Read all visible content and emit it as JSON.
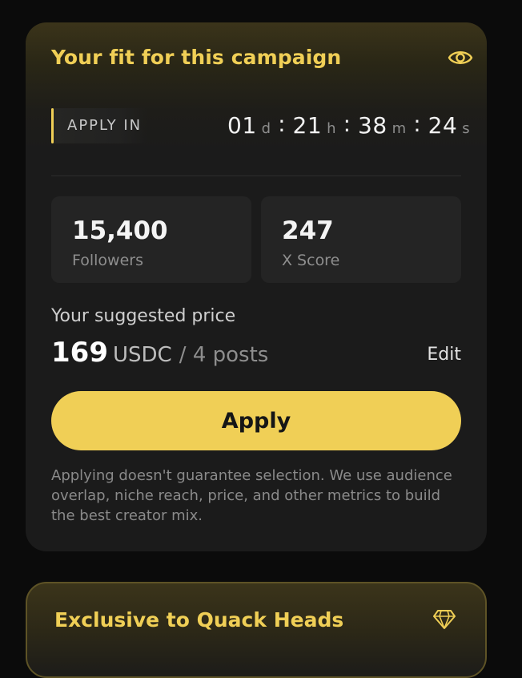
{
  "card": {
    "title": "Your fit for this campaign",
    "eye_icon": "eye-icon"
  },
  "countdown": {
    "label": "APPLY IN",
    "days": "01",
    "days_unit": "d",
    "hours": "21",
    "hours_unit": "h",
    "minutes": "38",
    "minutes_unit": "m",
    "seconds": "24",
    "seconds_unit": "s",
    "separator": ":"
  },
  "stats": [
    {
      "value": "15,400",
      "label": "Followers"
    },
    {
      "value": "247",
      "label": "X Score"
    }
  ],
  "price": {
    "label": "Your suggested price",
    "amount": "169",
    "currency": "USDC",
    "per": "/ 4 posts",
    "edit_label": "Edit"
  },
  "apply_button": {
    "label": "Apply"
  },
  "disclaimer": "Applying doesn't guarantee selection. We use audience overlap, niche reach, price, and other metrics to build the best creator mix.",
  "exclusive": {
    "title": "Exclusive to Quack Heads",
    "icon": "diamond-icon"
  },
  "colors": {
    "accent": "#f0cf56",
    "background": "#0b0b0b",
    "card": "#1b1b1b",
    "stat_bg": "#242424"
  }
}
